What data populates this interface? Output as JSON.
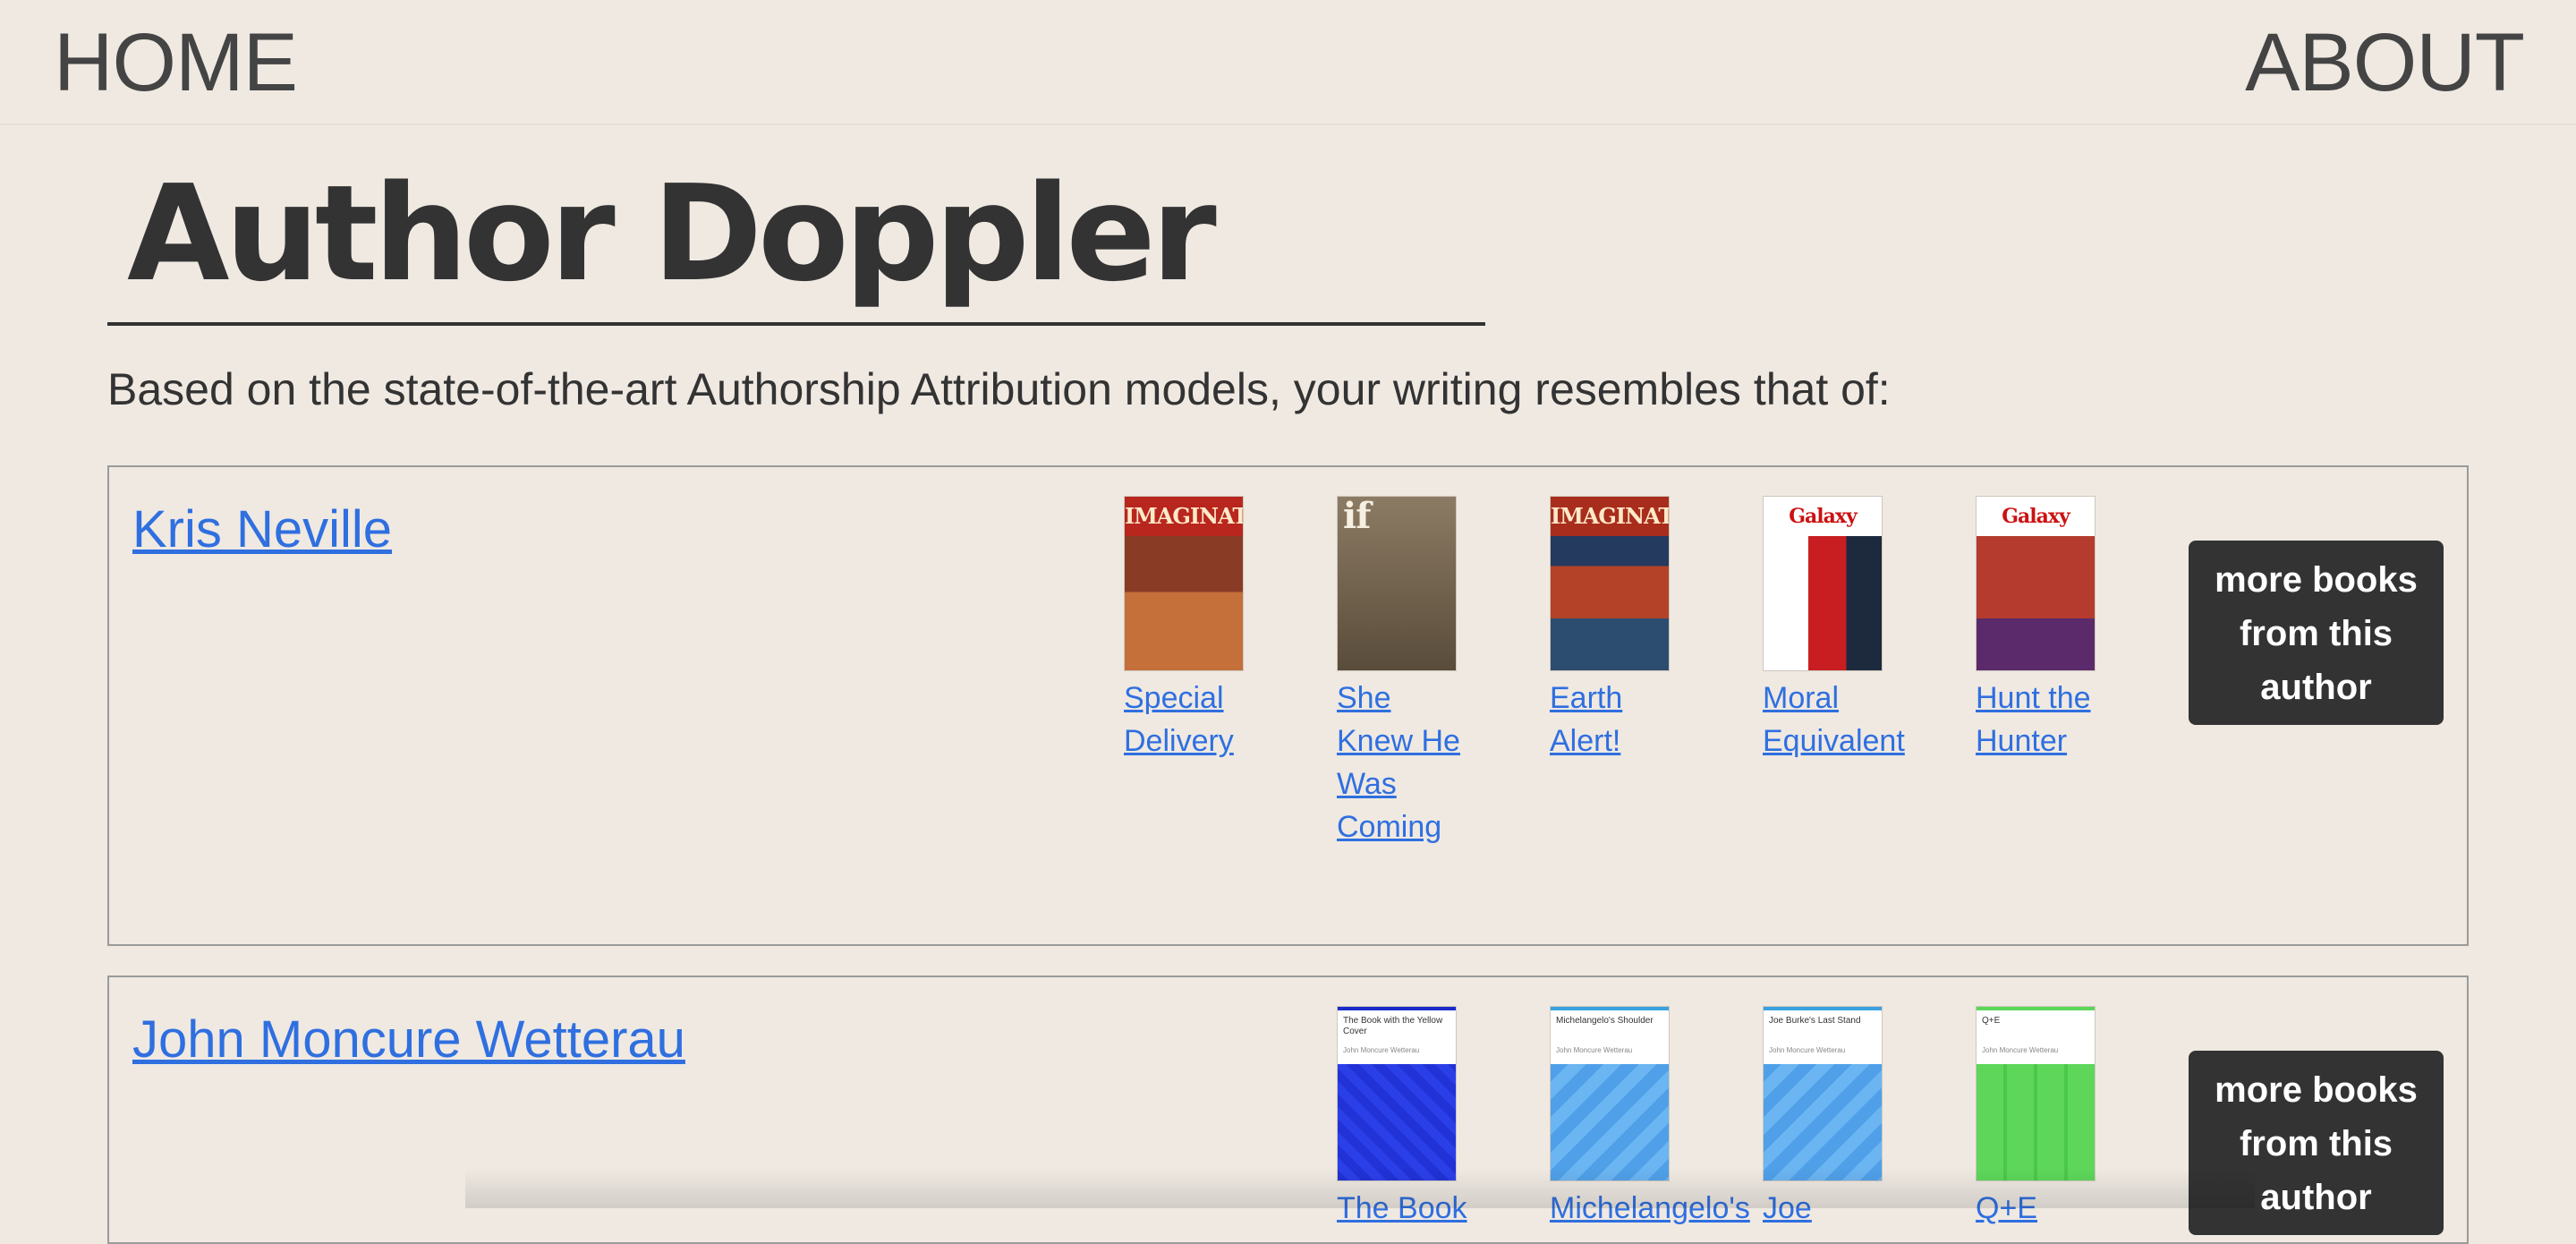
{
  "nav": {
    "home": "HOME",
    "about": "ABOUT"
  },
  "page": {
    "title": "Author Doppler",
    "intro": "Based on the state-of-the-art Authorship Attribution models, your writing resembles that of:"
  },
  "authors": [
    {
      "name": "Kris Neville",
      "more_label": "more books from this author",
      "books": [
        {
          "title": "Special Delivery",
          "cover_text": "IMAGINATION"
        },
        {
          "title": "She Knew He Was Coming",
          "cover_text": "if"
        },
        {
          "title": "Earth Alert!",
          "cover_text": "IMAGINATION"
        },
        {
          "title": "Moral Equivalent",
          "cover_text": "Galaxy"
        },
        {
          "title": "Hunt the Hunter",
          "cover_text": "Galaxy"
        }
      ]
    },
    {
      "name": "John Moncure Wetterau",
      "more_label": "more books from this author",
      "books": [
        {
          "title": "The Book",
          "cover_title": "The Book with the Yellow Cover",
          "cover_author": "John Moncure Wetterau"
        },
        {
          "title": "Michelangelo's",
          "cover_title": "Michelangelo's Shoulder",
          "cover_author": "John Moncure Wetterau"
        },
        {
          "title": "Joe",
          "cover_title": "Joe Burke's Last Stand",
          "cover_author": "John Moncure Wetterau"
        },
        {
          "title": "Q+E",
          "cover_title": "Q+E",
          "cover_author": "John Moncure Wetterau"
        }
      ]
    }
  ],
  "colors": {
    "link": "#2f6fe0",
    "button_bg": "#333333",
    "page_bg": "#efe9e2"
  }
}
